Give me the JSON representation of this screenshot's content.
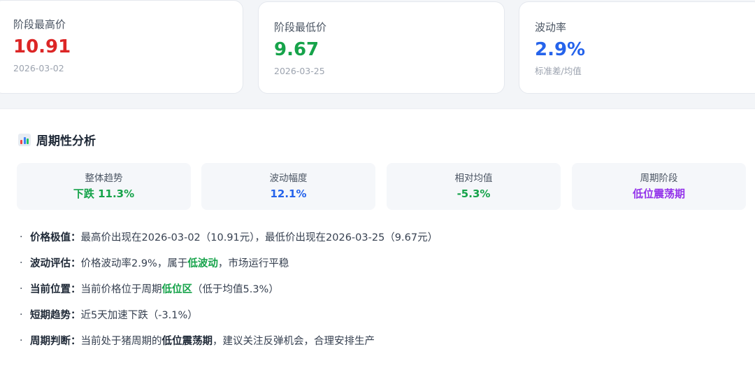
{
  "stats": [
    {
      "label": "阶段最高价",
      "value": "10.91",
      "sub": "2026-03-02",
      "color": "#dc2626"
    },
    {
      "label": "阶段最低价",
      "value": "9.67",
      "sub": "2026-03-25",
      "color": "#16a34a"
    },
    {
      "label": "波动率",
      "value": "2.9%",
      "sub": "标准差/均值",
      "color": "#2563eb"
    }
  ],
  "panel": {
    "title": "周期性分析",
    "title_icon": "bar-chart-icon",
    "metrics": [
      {
        "label": "整体趋势",
        "value": "下跌 11.3%",
        "color": "#16a34a"
      },
      {
        "label": "波动幅度",
        "value": "12.1%",
        "color": "#2563eb"
      },
      {
        "label": "相对均值",
        "value": "-5.3%",
        "color": "#16a34a"
      },
      {
        "label": "周期阶段",
        "value": "低位震荡期",
        "color": "#9333ea"
      }
    ],
    "items": [
      {
        "bullet": "·",
        "key": "价格极值：",
        "pre": "最高价出现在2026-03-02（10.91元），最低价出现在2026-03-25（9.67元）",
        "hl": "",
        "post": ""
      },
      {
        "bullet": "·",
        "key": "波动评估：",
        "pre": "价格波动率2.9%，属于",
        "hl": "低波动",
        "post": "，市场运行平稳"
      },
      {
        "bullet": "·",
        "key": "当前位置：",
        "pre": "当前价格位于周期",
        "hl": "低位区",
        "post": "（低于均值5.3%）"
      },
      {
        "bullet": "·",
        "key": "短期趋势：",
        "pre": "近5天加速下跌（-3.1%）",
        "hl": "",
        "post": ""
      },
      {
        "bullet": "·",
        "key": "周期判断：",
        "pre": "当前处于猪周期的",
        "hl": "低位震荡期",
        "post": "，建议关注反弹机会，合理安排生产"
      }
    ]
  }
}
